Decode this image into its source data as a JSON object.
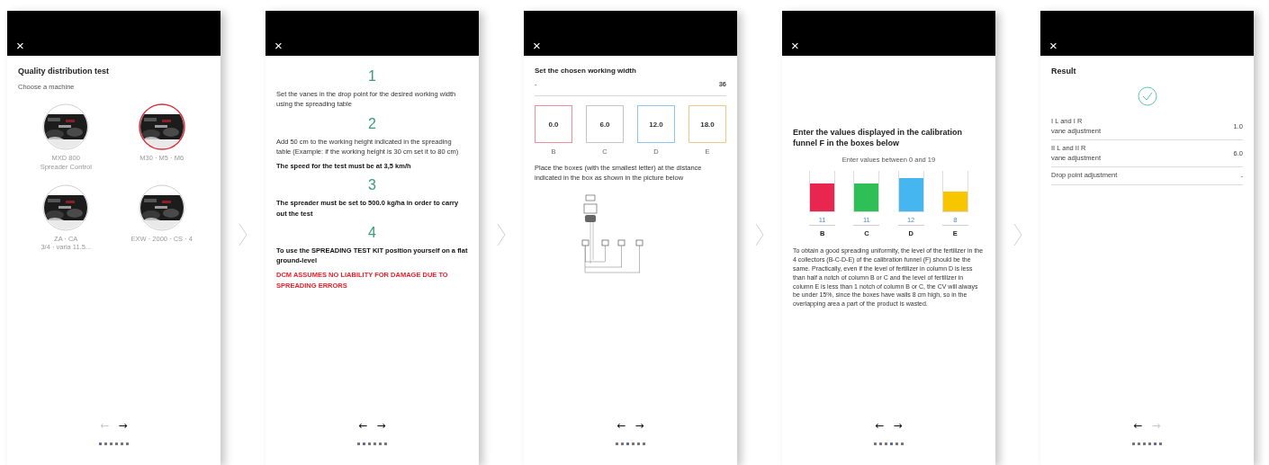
{
  "screens": [
    {
      "kind": "machine_select",
      "close": "×",
      "title": "Quality distribution test",
      "subtitle": "Choose a machine",
      "machines": [
        {
          "lines": [
            "MXD 800",
            "Spreader Control"
          ],
          "selected": false
        },
        {
          "lines": [
            "M30 · M5 · M6"
          ],
          "selected": true
        },
        {
          "lines": [
            "ZA · CA",
            "3/4 · varia 11.5..."
          ],
          "selected": false
        },
        {
          "lines": [
            "EXW · 2000 · CS · 4"
          ],
          "selected": false
        }
      ],
      "nav": {
        "back": "←",
        "back_disabled": true,
        "next": "→",
        "next_disabled": false,
        "dots": [
          {
            "selected": true
          },
          {
            "selected": false
          },
          {
            "selected": false
          },
          {
            "selected": false
          },
          {
            "selected": false
          },
          {
            "selected": false
          }
        ]
      }
    },
    {
      "kind": "instructions",
      "close": "×",
      "steps": [
        {
          "number": "1",
          "paragraphs": [
            {
              "kind": "plain",
              "text": "Set the vanes in the drop point for the desired working width using the spreading table"
            }
          ]
        },
        {
          "number": "2",
          "paragraphs": [
            {
              "kind": "plain",
              "text": "Add 50 cm to the working height indicated in the spreading table (Example: if the working height is 30 cm set it to 80 cm)"
            },
            {
              "kind": "bold",
              "text": "The speed for the test must be at 3,5 km/h"
            }
          ]
        },
        {
          "number": "3",
          "paragraphs": [
            {
              "kind": "bold",
              "text": "The spreader must be set to 500.0 kg/ha in order to carry out the test"
            }
          ]
        },
        {
          "number": "4",
          "paragraphs": [
            {
              "kind": "bold",
              "text": "To use the SPREADING TEST KIT position yourself on a flat ground-level"
            },
            {
              "kind": "warning",
              "text": "DCM ASSUMES NO LIABILITY FOR DAMAGE DUE TO SPREADING ERRORS"
            }
          ]
        }
      ],
      "nav": {
        "back": "←",
        "back_disabled": false,
        "next": "→",
        "next_disabled": false,
        "dots": [
          {
            "selected": false
          },
          {
            "selected": true
          },
          {
            "selected": false
          },
          {
            "selected": false
          },
          {
            "selected": false
          },
          {
            "selected": false
          }
        ]
      }
    },
    {
      "kind": "working_width",
      "close": "×",
      "title": "Set the chosen working width",
      "slider": {
        "min_label": "-",
        "max_label": "36",
        "level": 1
      },
      "boxes": [
        {
          "value": "0.0",
          "letter": "B",
          "color": "#ec8f9f"
        },
        {
          "value": "6.0",
          "letter": "C",
          "color": "#c4c4c4"
        },
        {
          "value": "12.0",
          "letter": "D",
          "color": "#8fc4e8"
        },
        {
          "value": "18.0",
          "letter": "E",
          "color": "#f0c88a"
        }
      ],
      "note": "Place the boxes (with the smallest letter) at the distance indicated in the box as shown in the picture below",
      "nav": {
        "back": "←",
        "back_disabled": false,
        "next": "→",
        "next_disabled": false,
        "dots": [
          {
            "selected": false
          },
          {
            "selected": false
          },
          {
            "selected": true
          },
          {
            "selected": false
          },
          {
            "selected": false
          },
          {
            "selected": false
          }
        ]
      }
    },
    {
      "kind": "funnel_values",
      "close": "×",
      "title": "Enter the values displayed in the calibration funnel F in the boxes below",
      "hint": "Enter values between 0 and 19",
      "columns": [
        {
          "value": "11",
          "letter": "B",
          "color": "#e8264f",
          "level": 0.7
        },
        {
          "value": "11",
          "letter": "C",
          "color": "#2fbf57",
          "level": 0.7
        },
        {
          "value": "12",
          "letter": "D",
          "color": "#45b6f0",
          "level": 0.83
        },
        {
          "value": "8",
          "letter": "E",
          "color": "#f7c600",
          "level": 0.5
        }
      ],
      "paragraph": "To obtain a good spreading uniformity, the level of the fertilizer in the 4 collectors (B-C-D-E) of the calibration funnel (F) should be the same. Practically, even if the level of fertilizer in column D is less than half a notch of column B or C and the level of fertilizer in column E is less than 1 notch of column B or C, the CV will always be under 15%, since the boxes have walls 8 cm high, so in the overlapping area a part of the product is wasted.",
      "nav": {
        "back": "←",
        "back_disabled": false,
        "next": "→",
        "next_disabled": false,
        "dots": [
          {
            "selected": false
          },
          {
            "selected": false
          },
          {
            "selected": false
          },
          {
            "selected": true
          },
          {
            "selected": false
          },
          {
            "selected": false
          }
        ]
      }
    },
    {
      "kind": "result",
      "close": "×",
      "title": "Result",
      "rows": [
        {
          "lines": [
            "I L and I R",
            "vane adjustment"
          ],
          "value": "1.0"
        },
        {
          "lines": [
            "II L and II R",
            "vane adjustment"
          ],
          "value": "6.0"
        },
        {
          "lines": [
            "Drop point adjustment"
          ],
          "value": "-"
        }
      ],
      "nav": {
        "back": "←",
        "back_disabled": false,
        "next": "→",
        "next_disabled": true,
        "dots": [
          {
            "selected": false
          },
          {
            "selected": false
          },
          {
            "selected": false
          },
          {
            "selected": false
          },
          {
            "selected": true
          },
          {
            "selected": false
          }
        ]
      }
    }
  ]
}
